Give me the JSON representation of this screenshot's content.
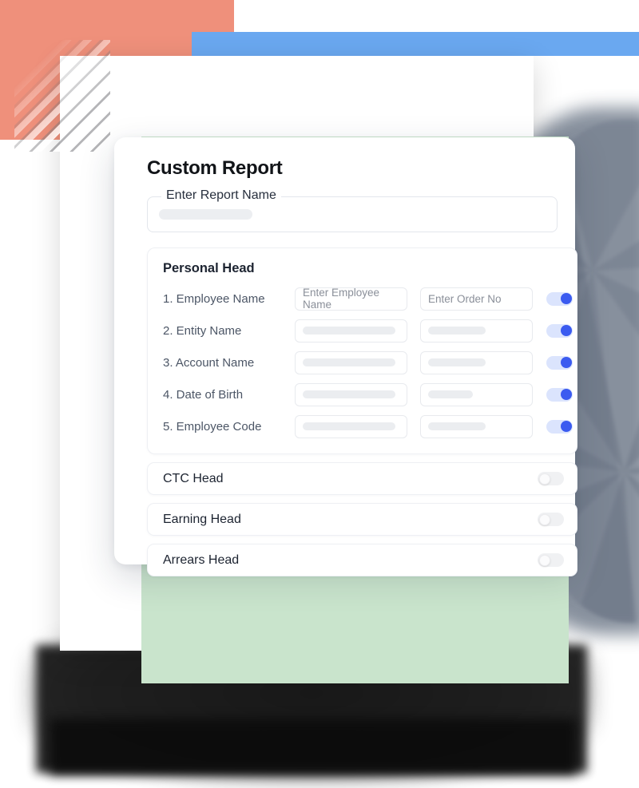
{
  "modal": {
    "title": "Custom Report",
    "report_name_field": {
      "legend": "Enter Report Name",
      "value": ""
    },
    "personal_head": {
      "title": "Personal Head",
      "rows": [
        {
          "label": "1. Employee Name",
          "field_a": "Enter Employee Name",
          "field_b": "Enter Order No",
          "toggle": "on"
        },
        {
          "label": "2. Entity Name",
          "field_a": "",
          "field_b": "",
          "toggle": "on"
        },
        {
          "label": "3. Account Name",
          "field_a": "",
          "field_b": "",
          "toggle": "on"
        },
        {
          "label": "4. Date of Birth",
          "field_a": "",
          "field_b": "",
          "toggle": "on"
        },
        {
          "label": "5. Employee Code",
          "field_a": "",
          "field_b": "",
          "toggle": "on"
        }
      ]
    },
    "collapsed_sections": [
      {
        "label": "CTC Head",
        "toggle": "off"
      },
      {
        "label": "Earning Head",
        "toggle": "off"
      },
      {
        "label": "Arrears Head",
        "toggle": "off"
      }
    ]
  },
  "theme": {
    "coral": "#ef907b",
    "blue_bar": "#6aa8f0",
    "green_panel": "#c9e4cc",
    "green_dot": "#5dd08a",
    "toggle_on_track": "#dbe4fd",
    "toggle_on_knob": "#3b5bf0",
    "toggle_off_track": "#f0f1f3",
    "grey_slab": "#7d8795",
    "placeholder_text": "#8a8f99"
  }
}
